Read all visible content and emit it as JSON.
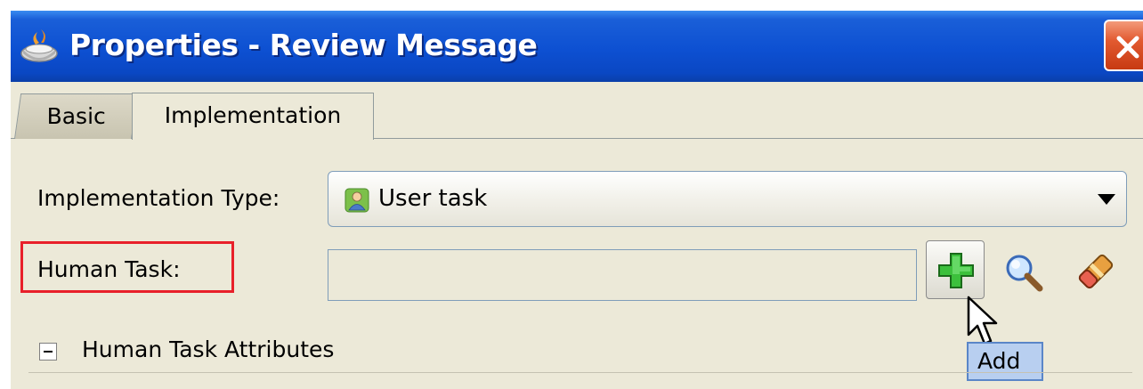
{
  "window": {
    "title": "Properties - Review Message"
  },
  "tabs": [
    {
      "label": "Basic",
      "active": false
    },
    {
      "label": "Implementation",
      "active": true
    }
  ],
  "form": {
    "implementation_type": {
      "label": "Implementation Type:",
      "value": "User task",
      "icon": "user-task-icon"
    },
    "human_task": {
      "label": "Human Task:",
      "value": ""
    }
  },
  "actions": {
    "add_icon": "green-plus-icon",
    "search_icon": "magnifier-icon",
    "clear_icon": "eraser-icon"
  },
  "tooltip": {
    "text": "Add"
  },
  "section": {
    "label": "Human Task Attributes",
    "expanded": true
  },
  "colors": {
    "titlebar": "#0d50d2",
    "dialog_bg": "#ece9d8",
    "highlight_box": "#e8202a",
    "tooltip_bg": "#b8cff0"
  }
}
